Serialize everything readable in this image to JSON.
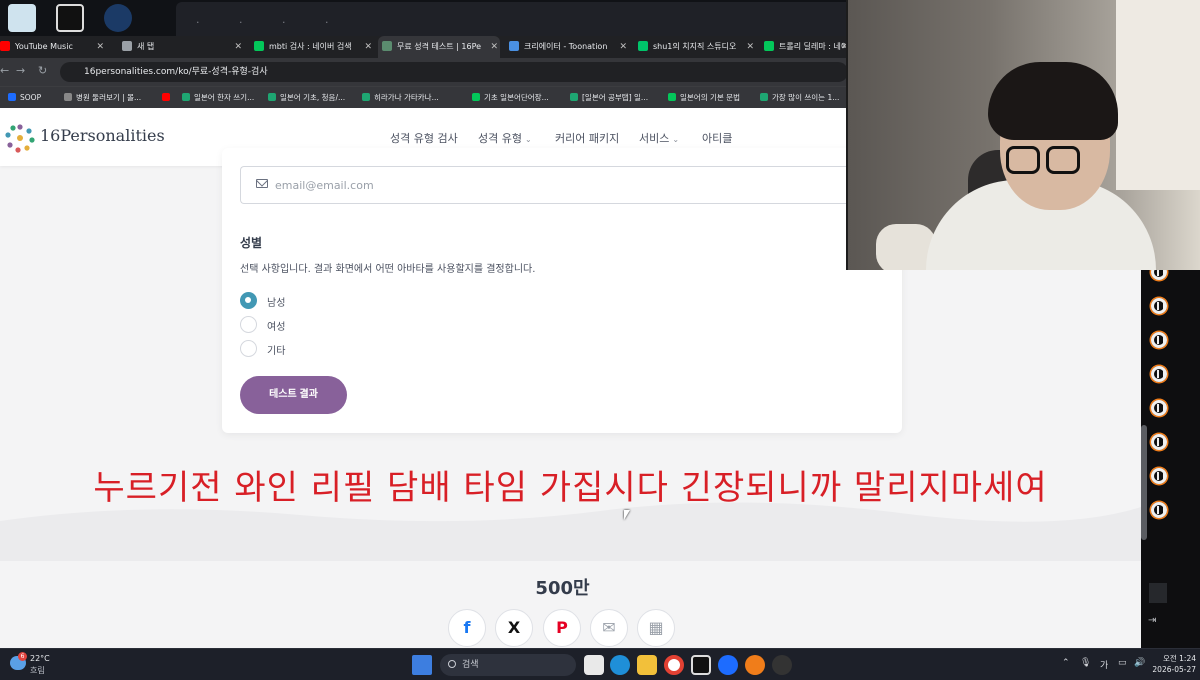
{
  "browser": {
    "tabs": [
      {
        "label": "YouTube Music",
        "color": "#ff0000",
        "active": false
      },
      {
        "label": "새 탭",
        "color": "#9aa0a6",
        "active": false
      },
      {
        "label": "mbti 검사 : 네이버 검색",
        "color": "#03c75a",
        "active": false
      },
      {
        "label": "무료 성격 테스트 | 16Pe",
        "color": "#5b8c6f",
        "active": true
      },
      {
        "label": "크리에이터 - Toonation",
        "color": "#4a90e2",
        "active": false
      },
      {
        "label": "shu1의 치지직 스튜디오",
        "color": "#00c46a",
        "active": false
      },
      {
        "label": "트롤리 딜레마 : 네이",
        "color": "#03c75a",
        "active": false
      }
    ],
    "url": "16personalities.com/ko/무료-성격-유형-검사",
    "bookmarks": [
      {
        "label": "SOOP",
        "color": "#1d6cff"
      },
      {
        "label": "병원 둘러보기 | 몰...",
        "color": "#888888"
      },
      {
        "label": "",
        "color": "#ff0000"
      },
      {
        "label": "일본어 한자 쓰기...",
        "color": "#1ea672"
      },
      {
        "label": "일본어 기초, 청음/...",
        "color": "#1ea672"
      },
      {
        "label": "히라가나 가타카나...",
        "color": "#1ea672"
      },
      {
        "label": "기초 일본어단어장...",
        "color": "#03c75a"
      },
      {
        "label": "[일본어 공부탭] 일...",
        "color": "#1ea672"
      },
      {
        "label": "일본어의 기본 문법",
        "color": "#03c75a"
      },
      {
        "label": "가장 많이 쓰이는 1...",
        "color": "#1ea672"
      }
    ]
  },
  "site": {
    "logo_text": "16Personalities",
    "nav": [
      "성격 유형 검사",
      "성격 유형",
      "커리어 패키지",
      "서비스",
      "아티클"
    ]
  },
  "form": {
    "email_placeholder": "email@email.com",
    "gender_label": "성별",
    "gender_desc": "선택 사항입니다. 결과 화면에서 어떤 아바타를 사용할지를 결정합니다.",
    "options": [
      "남성",
      "여성",
      "기타"
    ],
    "selected_index": 0,
    "submit_label": "테스트 결과"
  },
  "caption": "누르기전 와인 리필 담배 타임 가집시다 긴장되니까 말리지마세여",
  "share": {
    "count": "500만",
    "buttons": [
      {
        "name": "facebook",
        "glyph": "f",
        "color": "#1877f2"
      },
      {
        "name": "x",
        "glyph": "X",
        "color": "#111111"
      },
      {
        "name": "pinterest",
        "glyph": "P",
        "color": "#e60023"
      },
      {
        "name": "email",
        "glyph": "✉",
        "color": "#9aa0a9"
      },
      {
        "name": "qr",
        "glyph": "▦",
        "color": "#9aa0a9"
      }
    ]
  },
  "taskbar": {
    "temp": "22°C",
    "weather": "흐림",
    "weather_badge": "6",
    "search": "검색",
    "ime": "가",
    "time": "오전 1:24",
    "date": "2026-05-27"
  },
  "colors": {
    "accent": "#88619a",
    "radio": "#4298b4",
    "caption": "#d81f26"
  }
}
